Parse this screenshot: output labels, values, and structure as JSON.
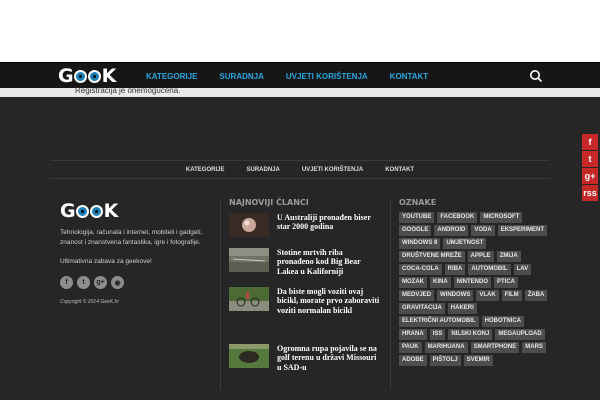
{
  "nav": {
    "logo_text": "GEEK",
    "items": [
      "KATEGORIJE",
      "SURADNJA",
      "UVJETI KORIŠTENJA",
      "KONTAKT"
    ],
    "search_icon": "search-icon"
  },
  "notice": "Registracija je onemogućena.",
  "footer_nav": [
    "KATEGORIJE",
    "SURADNJA",
    "UVJETI KORIŠTENJA",
    "KONTAKT"
  ],
  "about": {
    "description": "Tehnologija, računala i internet, mobiteli i gadgeti, znanost i znanstvena fantastika, igre i fotografije.",
    "tagline": "Ultimativna zabava za geekove!",
    "copyright": "Copyright © 2014 GeeK.hr",
    "social_icons": [
      "facebook-icon",
      "twitter-icon",
      "google-plus-icon",
      "rss-icon"
    ]
  },
  "latest": {
    "title": "NAJNOVIJI ČLANCI",
    "articles": [
      "U Australiji pronađen biser star 2000 godina",
      "Stotine mrtvih riba pronađeno kod Big Bear Lakea u Kaliforniji",
      "Da biste mogli voziti ovaj bicikl, morate prvo zaboraviti voziti normalan bicikl",
      "Ogromna rupa pojavila se na golf terenu u državi Missouri u SAD-u"
    ]
  },
  "tags": {
    "title": "OZNAKE",
    "items": [
      "YOUTUBE",
      "FACEBOOK",
      "MICROSOFT",
      "GOOGLE",
      "ANDROID",
      "VODA",
      "EKSPERIMENT",
      "WINDOWS 8",
      "UMJETNOST",
      "DRUŠTVENE MREŽE",
      "APPLE",
      "ZMIJA",
      "COCA-COLA",
      "RIBA",
      "AUTOMOBIL",
      "LAV",
      "MOZAK",
      "KINA",
      "NINTENDO",
      "PTICA",
      "MEDVJED",
      "WINDOWS",
      "VLAK",
      "FILM",
      "ŽABA",
      "GRAVITACIJA",
      "HAKERI",
      "ELEKTRIČNI AUTOMOBIL",
      "HOBOTNICA",
      "HRANA",
      "ISS",
      "NILSKI KONJ",
      "MEGAUPLOAD",
      "PAUK",
      "MARIHUANA",
      "SMARTPHONE",
      "MARS",
      "ADOBE",
      "PIŠTOLJ",
      "SVEMIR"
    ]
  },
  "float_social": [
    "f",
    "t",
    "g+",
    "rss"
  ],
  "colors": {
    "accent": "#2aa7e2",
    "dark_bg": "#262626",
    "nav_bg": "#161616",
    "social_red": "#c62828",
    "tag_bg": "#4d4d4d"
  }
}
